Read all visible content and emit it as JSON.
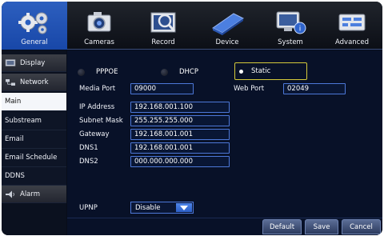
{
  "top_tabs": [
    {
      "label": "General",
      "icon": "gear-icon",
      "active": true
    },
    {
      "label": "Cameras",
      "icon": "camera-icon",
      "active": false
    },
    {
      "label": "Record",
      "icon": "record-icon",
      "active": false
    },
    {
      "label": "Device",
      "icon": "hard-disk-icon",
      "active": false
    },
    {
      "label": "System",
      "icon": "system-monitor-icon",
      "active": false
    },
    {
      "label": "Advanced",
      "icon": "advanced-settings-icon",
      "active": false
    }
  ],
  "sidebar": {
    "display": "Display",
    "network": "Network",
    "main": "Main",
    "substream": "Substream",
    "email": "Email",
    "email_schedule": "Email Schedule",
    "ddns": "DDNS",
    "alarm": "Alarm"
  },
  "network": {
    "modes": [
      "PPPOE",
      "DHCP",
      "Static"
    ],
    "selected_mode": "Static",
    "media_port_label": "Media Port",
    "media_port": "09000",
    "web_port_label": "Web Port",
    "web_port": "02049",
    "ip_label": "IP Address",
    "ip": "192.168.001.100",
    "subnet_label": "Subnet Mask",
    "subnet": "255.255.255.000",
    "gateway_label": "Gateway",
    "gateway": "192.168.001.001",
    "dns1_label": "DNS1",
    "dns1": "192.168.001.001",
    "dns2_label": "DNS2",
    "dns2": "000.000.000.000",
    "upnp_label": "UPNP",
    "upnp": "Disable"
  },
  "buttons": {
    "default": "Default",
    "save": "Save",
    "cancel": "Cancel"
  },
  "colors": {
    "active_tab": "#2358c0",
    "field_border": "#4d78d8",
    "selected_outline": "#d4c93a",
    "panel_bg": "#081128"
  }
}
